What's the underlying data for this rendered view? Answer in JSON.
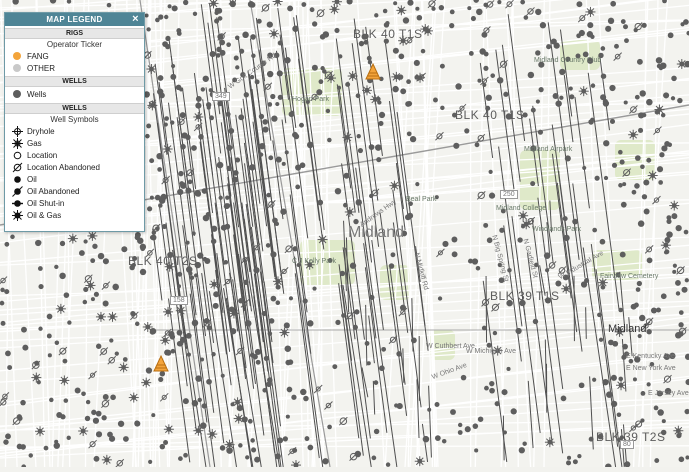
{
  "legend": {
    "title": "MAP LEGEND",
    "close": "×",
    "rigs": {
      "heading": "RIGS",
      "subheading": "Operator Ticker",
      "items": [
        {
          "label": "FANG",
          "color": "#f3a43b"
        },
        {
          "label": "OTHER",
          "color": "#c9c9c9"
        }
      ]
    },
    "wells": {
      "heading": "WELLS",
      "items": [
        {
          "label": "Wells",
          "color": "#5e5e5e"
        }
      ]
    },
    "symbols": {
      "heading": "WELLS",
      "subheading": "Well Symbols",
      "items": [
        {
          "label": "Dryhole",
          "icon": "dryhole-icon"
        },
        {
          "label": "Gas",
          "icon": "gas-icon"
        },
        {
          "label": "Location",
          "icon": "location-icon"
        },
        {
          "label": "Location Abandoned",
          "icon": "location-abandoned-icon"
        },
        {
          "label": "Oil",
          "icon": "oil-icon"
        },
        {
          "label": "Oil Abandoned",
          "icon": "oil-abandoned-icon"
        },
        {
          "label": "Oil Shut-in",
          "icon": "oil-shut-in-icon"
        },
        {
          "label": "Oil & Gas",
          "icon": "oil-and-gas-icon"
        }
      ]
    }
  },
  "map": {
    "block_labels": [
      "BLK 40 T1S",
      "BLK 40 T2S",
      "BLK 40 T1S",
      "BLK 39 T1S",
      "BLK 39 T2S"
    ],
    "city_labels": [
      "Midland",
      "Midland"
    ],
    "poi_labels": [
      "Midland Airpark",
      "Midland College",
      "Midland Country Club",
      "Hogan Park",
      "Fairview Cemetery",
      "Beal Park",
      "Windlands Park",
      "C J Kelly Park"
    ],
    "road_labels": [
      "W Cuthbert Ave",
      "W Ohio Ave",
      "W Michigan Ave",
      "E Kentucky Ave",
      "E New York Ave",
      "E Jersey Ave",
      "W Industrial Ave",
      "N Garfield St",
      "N Big Spring St",
      "N Midkiff Rd",
      "Andrews Hwy",
      "W Golf Course Rd"
    ],
    "route_shields": [
      "349",
      "158",
      "250",
      "80"
    ],
    "colors": {
      "wells": "#5e5e5e",
      "fang": "#f3a43b",
      "roads": "#ffffff",
      "parks": "#dfe9c9"
    }
  }
}
